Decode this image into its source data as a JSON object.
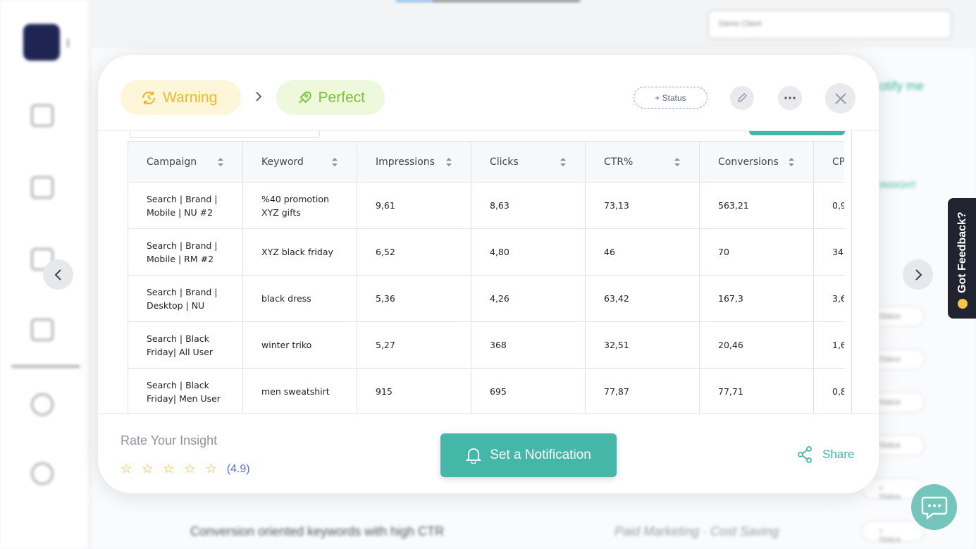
{
  "background": {
    "client_selector": "Demo Client",
    "notify_text": "otify me",
    "insight_text": "INSIGHT",
    "status_pill": "Status",
    "status_pill_plus": "+ Status",
    "row_text": "Conversion oriented keywords with high CTR",
    "row_category": "Paid Marketing · Cost Saving"
  },
  "modal": {
    "from_status": "Warning",
    "to_status": "Perfect",
    "status_button": "+ Status",
    "table": {
      "headers": [
        "Campaign",
        "Keyword",
        "Impressions",
        "Clicks",
        "CTR%",
        "Conversions",
        "CP"
      ],
      "rows": [
        [
          "Search | Brand | Mobile | NU #2",
          "%40 promotion XYZ gifts",
          "9,61",
          "8,63",
          "73,13",
          "563,21",
          "0,9"
        ],
        [
          "Search | Brand | Mobile | RM #2",
          "XYZ black friday",
          "6,52",
          "4,80",
          "46",
          "70",
          "34"
        ],
        [
          "Search | Brand | Desktop | NU",
          "black dress",
          "5,36",
          "4,26",
          "63,42",
          "167,3",
          "3,6"
        ],
        [
          "Search | Black Friday| All User",
          "winter triko",
          "5,27",
          "368",
          "32,51",
          "20,46",
          "1,6"
        ],
        [
          "Search | Black Friday| Men User",
          "men sweatshirt",
          "915",
          "695",
          "77,87",
          "77,71",
          "0,8"
        ]
      ]
    },
    "footer": {
      "rate_label": "Rate Your Insight",
      "rating": "(4.9)",
      "notify_button": "Set a Notification",
      "share_label": "Share"
    }
  },
  "feedback_tab": "Got Feedback?",
  "colors": {
    "accent": "#45b7a9",
    "warning": "#f0b92d",
    "perfect": "#7bc23b",
    "star": "#f4b71b",
    "rating_text": "#5b6ee1"
  }
}
